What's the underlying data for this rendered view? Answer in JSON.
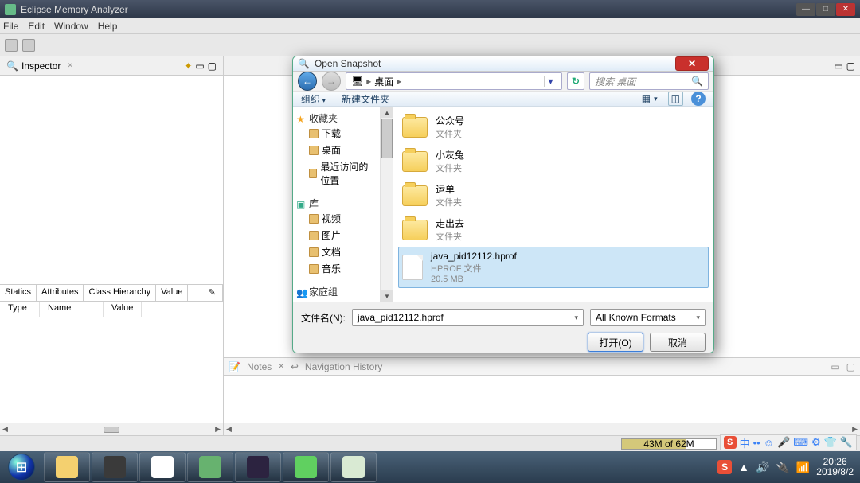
{
  "window": {
    "title": "Eclipse Memory Analyzer"
  },
  "menubar": [
    "File",
    "Edit",
    "Window",
    "Help"
  ],
  "inspector": {
    "tab": "Inspector",
    "close_glyph": "✕"
  },
  "attr_tabs": [
    "Statics",
    "Attributes",
    "Class Hierarchy",
    "Value"
  ],
  "attr_cols": [
    "Type",
    "Name",
    "Value"
  ],
  "notes": {
    "label": "Notes",
    "nav": "Navigation History"
  },
  "status": {
    "memory": "43M of 62M"
  },
  "dialog": {
    "title": "Open Snapshot",
    "breadcrumb": {
      "root_icon": "🖥",
      "seg": "桌面"
    },
    "search_placeholder": "搜索 桌面",
    "toolbar": {
      "org": "组织",
      "newfolder": "新建文件夹"
    },
    "tree": {
      "fav": {
        "label": "收藏夹",
        "children": [
          "下载",
          "桌面",
          "最近访问的位置"
        ]
      },
      "lib": {
        "label": "库",
        "children": [
          "视频",
          "图片",
          "文档",
          "音乐"
        ]
      },
      "home": {
        "label": "家庭组"
      }
    },
    "files": [
      {
        "name": "公众号",
        "sub": "文件夹",
        "type": "folder"
      },
      {
        "name": "小灰兔",
        "sub": "文件夹",
        "type": "folder"
      },
      {
        "name": "运单",
        "sub": "文件夹",
        "type": "folder"
      },
      {
        "name": "走出去",
        "sub": "文件夹",
        "type": "folder"
      },
      {
        "name": "java_pid12112.hprof",
        "sub": "HPROF 文件",
        "size": "20.5 MB",
        "type": "file",
        "selected": true
      }
    ],
    "filename_label": "文件名(N):",
    "filename_value": "java_pid12112.hprof",
    "format": "All Known Formats",
    "open": "打开(O)",
    "cancel": "取消"
  },
  "ime": {
    "logo": "S",
    "items": [
      "中",
      "••",
      "☺",
      "🎤",
      "⌨",
      "⚙",
      "👕",
      "🔧"
    ]
  },
  "taskbar": {
    "apps": [
      {
        "name": "explorer",
        "color": "#f4d06f"
      },
      {
        "name": "sublime",
        "color": "#3a3a3a"
      },
      {
        "name": "chrome",
        "color": "#ffffff"
      },
      {
        "name": "app-green",
        "color": "#67b26f"
      },
      {
        "name": "app-dark",
        "color": "#2c2340"
      },
      {
        "name": "wechat",
        "color": "#60d060"
      },
      {
        "name": "db-tool",
        "color": "#d9ead3"
      }
    ],
    "tray_logo": "S",
    "tray_icons": [
      "▲",
      "🔊",
      "🔌",
      "📶"
    ],
    "time": "20:26",
    "date": "2019/8/2"
  }
}
